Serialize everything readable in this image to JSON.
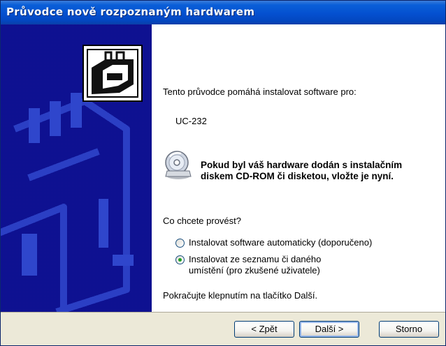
{
  "window": {
    "title": "Průvodce nově rozpoznaným hardwarem"
  },
  "main": {
    "intro": "Tento průvodce pomáhá instalovat software pro:",
    "device": "UC-232",
    "notice_line1": "Pokud byl váš hardware dodán s instalačním",
    "notice_line2": "diskem CD-ROM či disketou, vložte je nyní.",
    "question": "Co chcete provést?",
    "options": [
      {
        "label": "Instalovat software automaticky (doporučeno)",
        "checked": false
      },
      {
        "label_line1": "Instalovat ze seznamu či daného",
        "label_line2": "umístění (pro zkušené uživatele)",
        "checked": true
      }
    ],
    "continue_hint": "Pokračujte klepnutím na tlačítko Další."
  },
  "buttons": {
    "back": "< Zpět",
    "next": "Další >",
    "cancel": "Storno"
  },
  "icons": {
    "side_art": "hardware-wizard-banner",
    "header": "hardware-board-icon",
    "notice": "cd-rom-icon"
  },
  "colors": {
    "titlebar": "#0450d0",
    "side_panel": "#0a0a8a",
    "dialog_bg": "#ece9d8"
  }
}
